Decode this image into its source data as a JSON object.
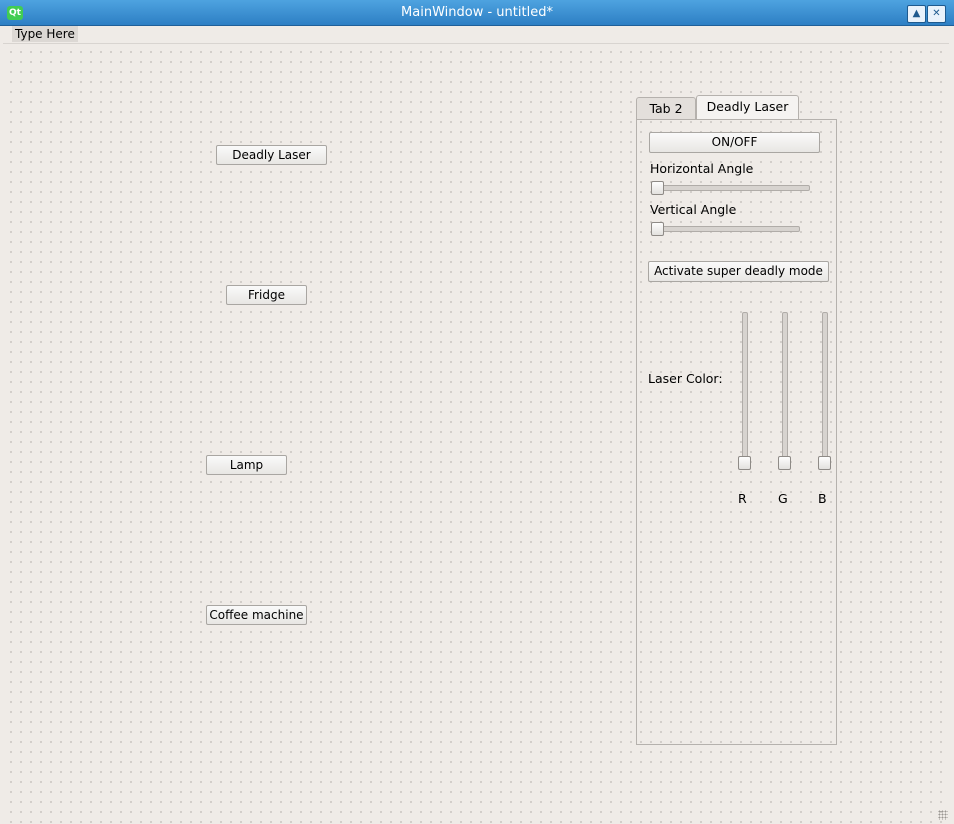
{
  "window": {
    "title": "MainWindow - untitled*",
    "app_icon": "Qt"
  },
  "title_buttons": {
    "maximize": "▲",
    "close": "✕"
  },
  "menubar": {
    "item": "Type Here"
  },
  "buttons": {
    "deadly_laser": "Deadly Laser",
    "fridge": "Fridge",
    "lamp": "Lamp",
    "coffee_machine": "Coffee machine"
  },
  "tabs": [
    {
      "label": "Tab 2",
      "active": false
    },
    {
      "label": "Deadly Laser",
      "active": true
    }
  ],
  "laser_tab": {
    "on_off": "ON/OFF",
    "horizontal_angle_label": "Horizontal Angle",
    "horizontal_angle_value": 0,
    "vertical_angle_label": "Vertical Angle",
    "vertical_angle_value": 0,
    "super_deadly": "Activate super deadly mode",
    "laser_color_label": "Laser Color:",
    "color_sliders": [
      {
        "label": "R",
        "value": 0
      },
      {
        "label": "G",
        "value": 0
      },
      {
        "label": "B",
        "value": 0
      }
    ]
  }
}
